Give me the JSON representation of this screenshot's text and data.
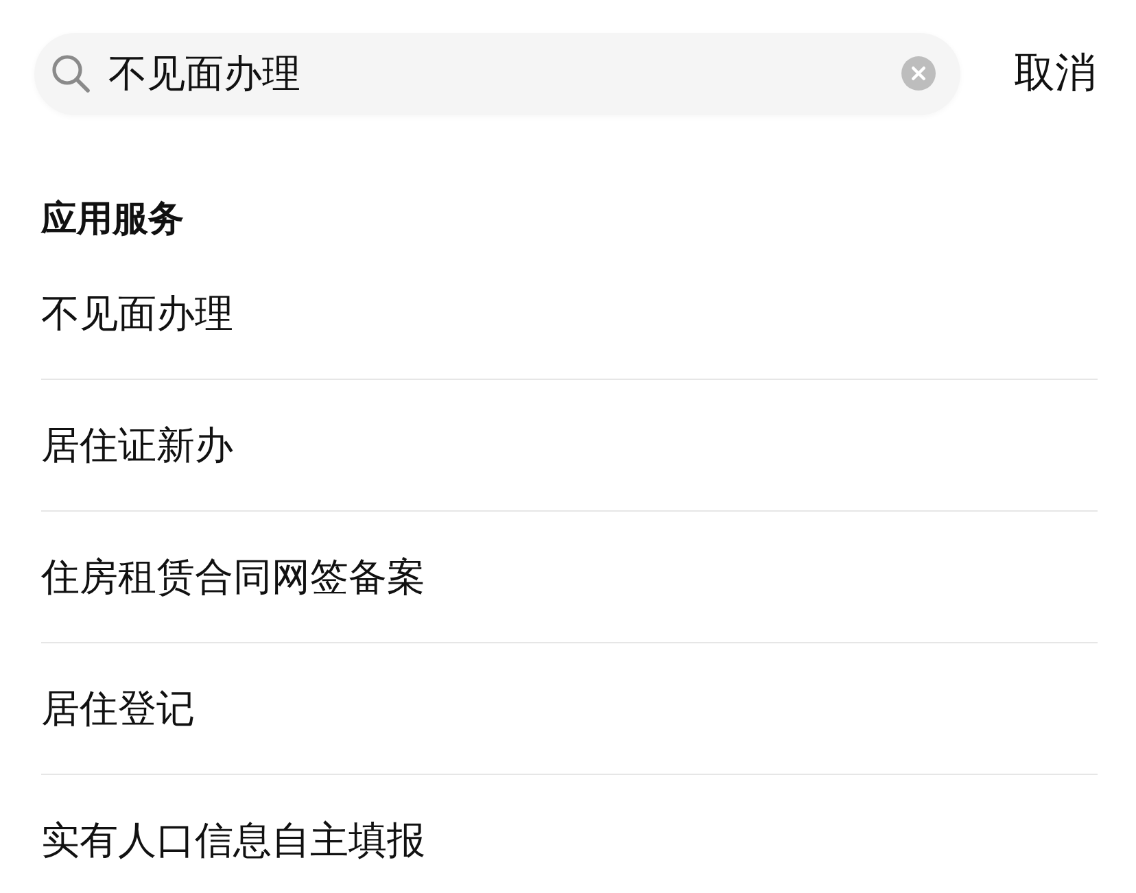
{
  "search": {
    "value": "不见面办理",
    "cancel_label": "取消"
  },
  "section": {
    "title": "应用服务",
    "items": [
      {
        "label": "不见面办理"
      },
      {
        "label": "居住证新办"
      },
      {
        "label": "住房租赁合同网签备案"
      },
      {
        "label": "居住登记"
      },
      {
        "label": "实有人口信息自主填报"
      }
    ]
  }
}
